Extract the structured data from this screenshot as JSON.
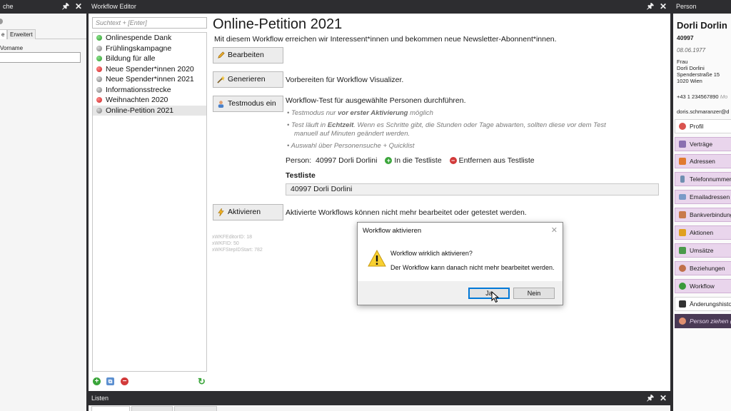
{
  "search_panel": {
    "title": "che",
    "tabs": [
      "e",
      "Erweitert"
    ],
    "field_label": "Vorname",
    "field_value": ""
  },
  "editor": {
    "title": "Workflow Editor",
    "search_placeholder": "Suchtext + [Enter]",
    "workflows": [
      {
        "label": "Onlinespende Dank",
        "status": "green"
      },
      {
        "label": "Frühlingskampagne",
        "status": "gray"
      },
      {
        "label": "Bildung für alle",
        "status": "green"
      },
      {
        "label": "Neue Spender*innen 2020",
        "status": "red"
      },
      {
        "label": "Neue Spender*innen 2021",
        "status": "gray"
      },
      {
        "label": "Informationsstrecke",
        "status": "gray"
      },
      {
        "label": "Weihnachten 2020",
        "status": "red"
      },
      {
        "label": "Online-Petition 2021",
        "status": "gray",
        "selected": true
      }
    ],
    "detail": {
      "heading": "Online-Petition 2021",
      "description": "Mit diesem Workflow erreichen wir Interessent*innen und bekommen neue Newsletter-Abonnent*innen.",
      "edit_button": "Bearbeiten",
      "generate_button": "Generieren",
      "generate_text": "Vorbereiten für Workflow Visualizer.",
      "test_button": "Testmodus ein",
      "test_text": "Workflow-Test für ausgewählte Personen durchführen.",
      "bullet1_pre": "Testmodus nur ",
      "bullet1_bold": "vor erster Aktivierung",
      "bullet1_post": " möglich",
      "bullet2_pre": "Test läuft in ",
      "bullet2_bold": "Echtzeit",
      "bullet2_post": ". Wenn es Schritte gibt, die Stunden oder Tage abwarten, sollten diese vor dem Test",
      "bullet2_line2": "manuell auf Minuten geändert werden.",
      "bullet3": "Auswahl über Personensuche + Quicklist",
      "person_label": "Person:",
      "person_value": "40997 Dorli Dorlini",
      "add_to_testlist": "In die Testliste",
      "remove_from_testlist": "Entfernen aus Testliste",
      "testlist_header": "Testliste",
      "testlist_entry": "40997 Dorli Dorlini",
      "activate_button": "Aktivieren",
      "activate_text": "Aktivierte Workflows können nicht mehr bearbeitet oder getestet werden.",
      "meta": [
        "xWKFEditorID: 18",
        "xWKFID: 50",
        "xWKFStepIDStart: 782"
      ]
    }
  },
  "lists_panel": {
    "title": "Listen"
  },
  "person": {
    "panel_title": "Person",
    "name": "Dorli Dorlin",
    "id": "40997",
    "birthdate": "08.06.1977",
    "salutation": "Frau",
    "full_name": "Dorli Dorlini",
    "street": "Spenderstraße 15",
    "city": "1020 Wien",
    "phone": "+43 1 234567890",
    "phone_type": "Mo",
    "email": "doris.schmaranzer@d",
    "nav": [
      {
        "label": "Profil",
        "style": "white",
        "color": "#d9534f"
      },
      {
        "label": "Verträge",
        "style": "normal",
        "color": "#8a6fb0"
      },
      {
        "label": "Adressen",
        "style": "normal",
        "color": "#e07a2f"
      },
      {
        "label": "Telefonnummern",
        "style": "normal",
        "color": "#6f8fb0"
      },
      {
        "label": "Emailadressen",
        "style": "normal",
        "color": "#7a9ac8"
      },
      {
        "label": "Bankverbindung",
        "style": "normal",
        "color": "#c87a4a"
      },
      {
        "label": "Aktionen",
        "style": "normal",
        "color": "#e0a020"
      },
      {
        "label": "Umsätze",
        "style": "normal",
        "color": "#4a9a4a"
      },
      {
        "label": "Beziehungen",
        "style": "normal",
        "color": "#c0704a"
      },
      {
        "label": "Workflow",
        "style": "normal",
        "color": "#3a9a3a"
      },
      {
        "label": "Änderungshistorie",
        "style": "white",
        "color": "#333333"
      },
      {
        "label": "Person ziehen (",
        "style": "dark",
        "color": "#e09070"
      }
    ]
  },
  "dialog": {
    "title": "Workflow aktivieren",
    "message": "Workflow wirklich aktivieren?",
    "detail": "Der Workflow kann danach nicht mehr bearbeitet werden.",
    "yes": "Ja",
    "no": "Nein"
  },
  "colors": {
    "titlebar": "#2d2d30",
    "accent_purple": "#e9d5ec",
    "dialog_focus": "#0078d7"
  }
}
